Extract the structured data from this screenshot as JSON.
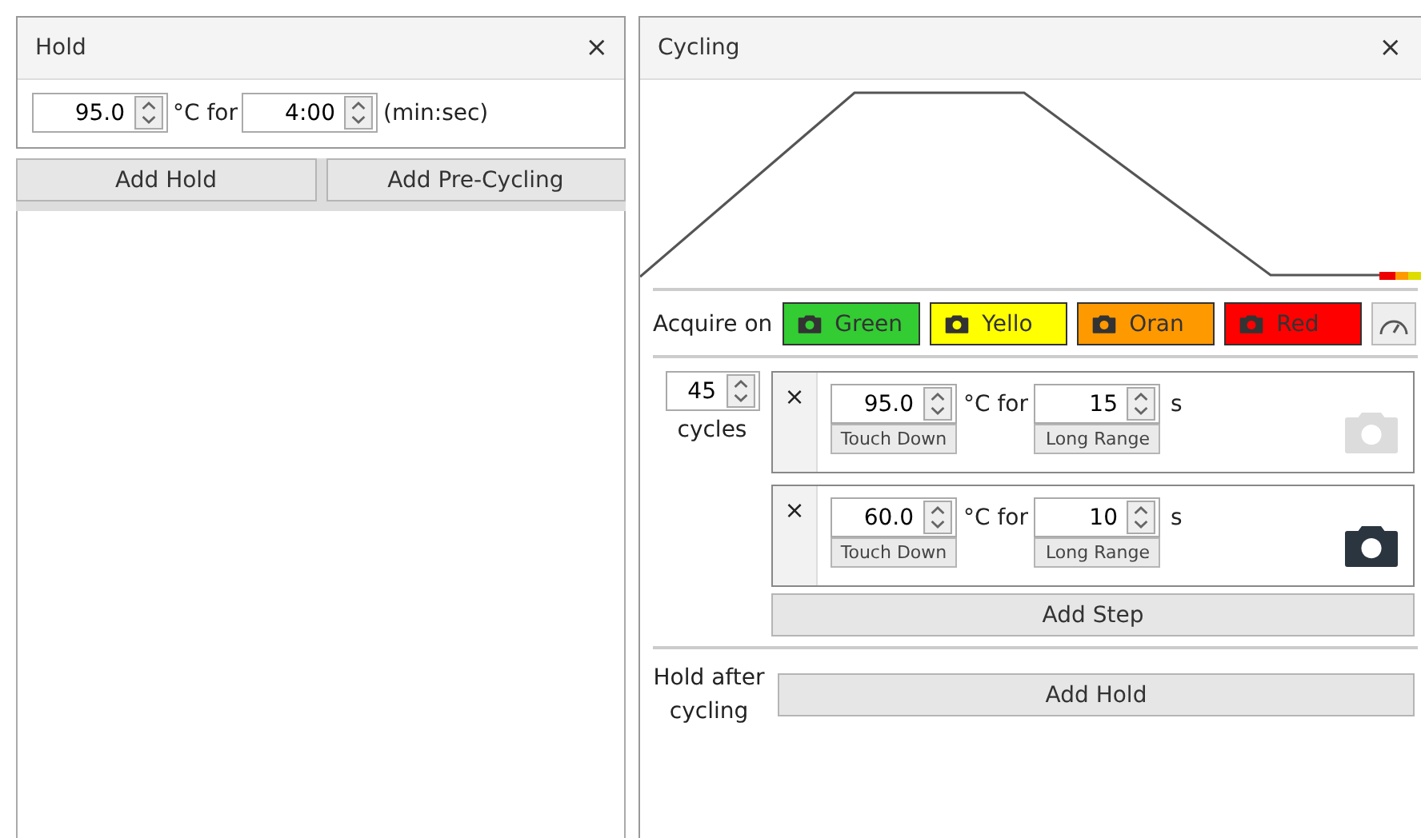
{
  "hold_panel": {
    "title": "Hold",
    "close": "×",
    "temperature": "95.0",
    "temp_label": "°C for",
    "time": "4:00",
    "time_unit": "(min:sec)"
  },
  "hold_buttons": [
    "Add Hold",
    "Add Pre-Cycling"
  ],
  "cycling_panel": {
    "title": "Cycling",
    "close": "×",
    "acquire_label": "Acquire on",
    "channels": [
      {
        "label": "Green",
        "color": "#33cc33"
      },
      {
        "label": "Yello",
        "color": "#ffff00"
      },
      {
        "label": "Oran",
        "color": "#ff9900"
      },
      {
        "label": "Red",
        "color": "#ff0000"
      }
    ],
    "cycles": "45",
    "cycles_label": "cycles",
    "steps": [
      {
        "remove": "×",
        "temperature": "95.0",
        "temp_mode": "Touch Down",
        "temp_label": "°C for",
        "time": "15",
        "time_mode": "Long Range",
        "time_unit": "s",
        "acquire": false
      },
      {
        "remove": "×",
        "temperature": "60.0",
        "temp_mode": "Touch Down",
        "temp_label": "°C for",
        "time": "10",
        "time_mode": "Long Range",
        "time_unit": "s",
        "acquire": true
      }
    ],
    "add_step": "Add Step",
    "hold_after_label": "Hold after cycling",
    "add_hold": "Add Hold"
  }
}
